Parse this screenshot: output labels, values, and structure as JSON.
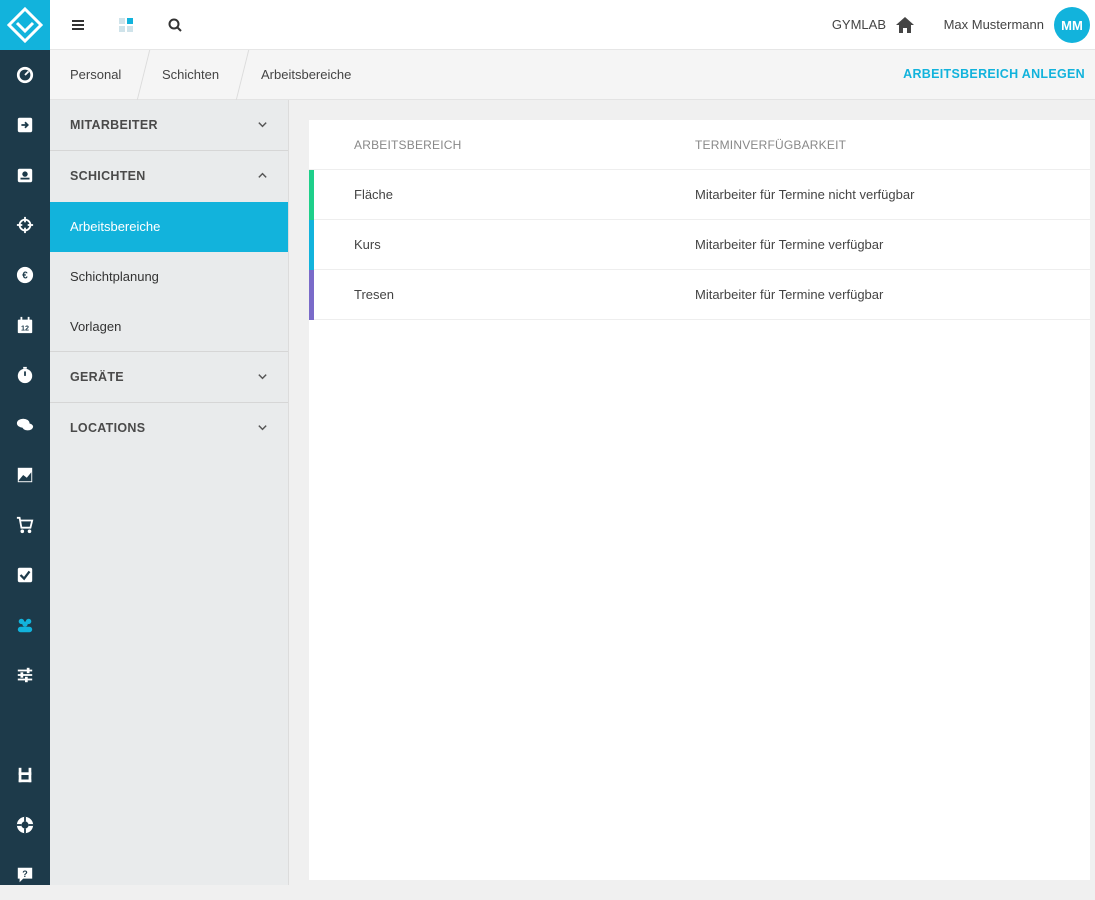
{
  "topbar": {
    "gym_name": "GYMLAB",
    "user_name": "Max Mustermann",
    "avatar_initials": "MM",
    "accent_color": "#12b3dc"
  },
  "breadcrumb": {
    "items": [
      "Personal",
      "Schichten",
      "Arbeitsbereiche"
    ],
    "action_label": "ARBEITSBEREICH ANLEGEN"
  },
  "sidebar": {
    "sections": [
      {
        "label": "MITARBEITER",
        "state": "collapsed"
      },
      {
        "label": "SCHICHTEN",
        "state": "expanded",
        "items": [
          "Arbeitsbereiche",
          "Schichtplanung",
          "Vorlagen"
        ],
        "active": "Arbeitsbereiche"
      },
      {
        "label": "GERÄTE",
        "state": "collapsed"
      },
      {
        "label": "LOCATIONS",
        "state": "collapsed"
      }
    ]
  },
  "rail_icons": [
    "dashboard-icon",
    "checkin-icon",
    "contacts-icon",
    "crosshair-icon",
    "euro-icon",
    "calendar-icon",
    "timer-icon",
    "chat-icon",
    "image-icon",
    "cart-icon",
    "checkbox-icon",
    "people-icon",
    "sliders-icon",
    "store-icon",
    "lifebuoy-icon",
    "help-icon"
  ],
  "table": {
    "columns": [
      "ARBEITSBEREICH",
      "TERMINVERFÜGBARKEIT"
    ],
    "rows": [
      {
        "name": "Fläche",
        "availability": "Mitarbeiter für Termine nicht verfügbar",
        "color": "#1ecf8a"
      },
      {
        "name": "Kurs",
        "availability": "Mitarbeiter für Termine verfügbar",
        "color": "#12b3dc"
      },
      {
        "name": "Tresen",
        "availability": "Mitarbeiter für Termine verfügbar",
        "color": "#7a6bc9"
      }
    ]
  }
}
